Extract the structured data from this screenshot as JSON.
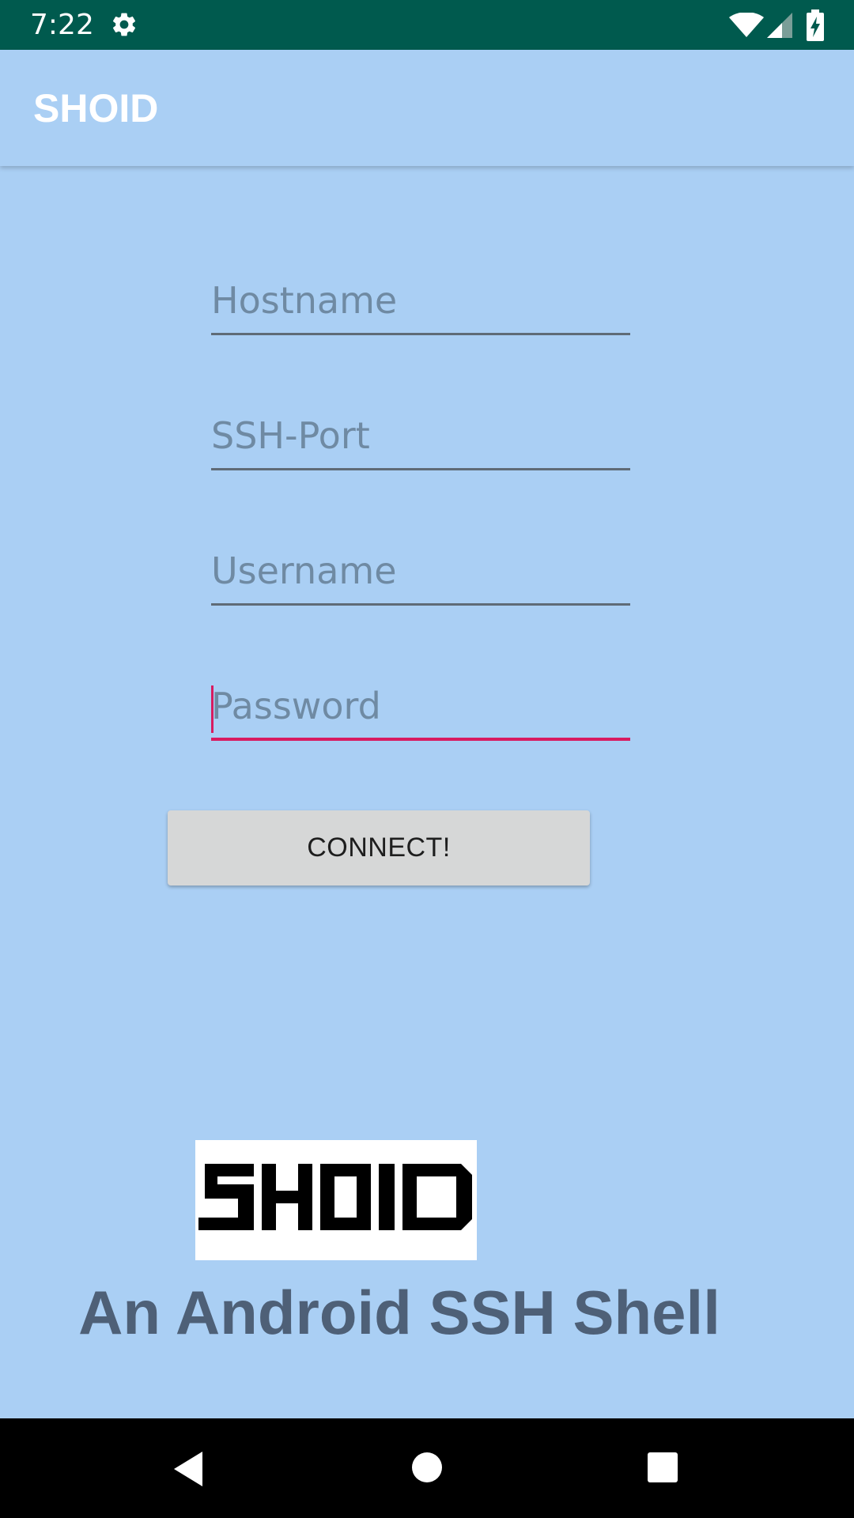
{
  "status_bar": {
    "time": "7:22",
    "icons": [
      "gear-icon",
      "wifi-icon",
      "signal-icon",
      "battery-charging-icon"
    ]
  },
  "app_bar": {
    "title": "SHOID"
  },
  "form": {
    "hostname_placeholder": "Hostname",
    "sshport_placeholder": "SSH-Port",
    "username_placeholder": "Username",
    "password_placeholder": "Password",
    "connect_label": "CONNECT!"
  },
  "branding": {
    "logo_text": "SHOID",
    "tagline": "An Android SSH Shell"
  },
  "colors": {
    "background": "#aacff4",
    "status_bar": "#005a4e",
    "focus_accent": "#d81b60",
    "button": "#d6d7d7",
    "tagline": "#4e6077"
  },
  "nav_bar": {
    "icons": [
      "back-icon",
      "home-icon",
      "recents-icon"
    ]
  }
}
